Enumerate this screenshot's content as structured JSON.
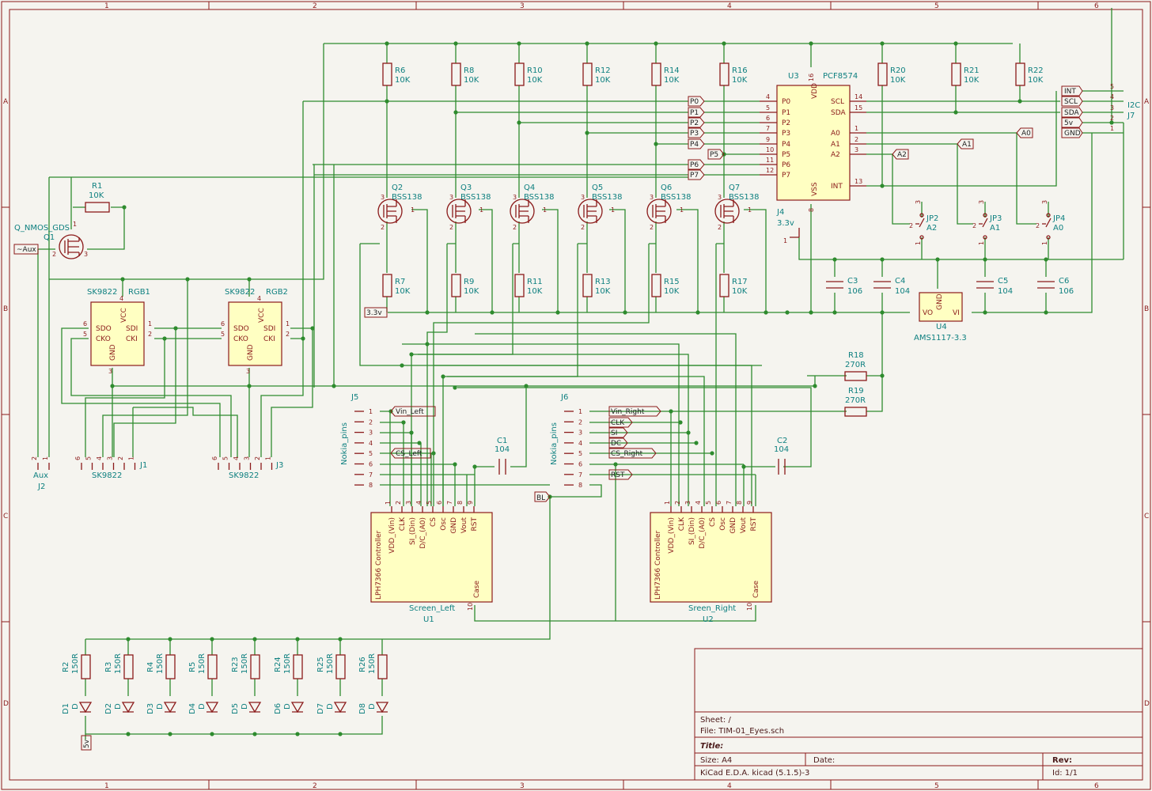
{
  "grid": {
    "cols": [
      "1",
      "2",
      "3",
      "4",
      "5",
      "6"
    ],
    "rows": [
      "A",
      "B",
      "C",
      "D"
    ]
  },
  "q1": {
    "ref": "Q1",
    "name": "Q_NMOS_GDS"
  },
  "r1": {
    "ref": "R1",
    "value": "10K"
  },
  "aux_label": "~Aux",
  "pullups": [
    {
      "ref": "R6",
      "value": "10K"
    },
    {
      "ref": "R8",
      "value": "10K"
    },
    {
      "ref": "R10",
      "value": "10K"
    },
    {
      "ref": "R12",
      "value": "10K"
    },
    {
      "ref": "R14",
      "value": "10K"
    },
    {
      "ref": "R16",
      "value": "10K"
    }
  ],
  "fets": [
    {
      "ref": "Q2",
      "part": "BSS138"
    },
    {
      "ref": "Q3",
      "part": "BSS138"
    },
    {
      "ref": "Q4",
      "part": "BSS138"
    },
    {
      "ref": "Q5",
      "part": "BSS138"
    },
    {
      "ref": "Q6",
      "part": "BSS138"
    },
    {
      "ref": "Q7",
      "part": "BSS138"
    }
  ],
  "pulldowns": [
    {
      "ref": "R7",
      "value": "10K"
    },
    {
      "ref": "R9",
      "value": "10K"
    },
    {
      "ref": "R11",
      "value": "10K"
    },
    {
      "ref": "R13",
      "value": "10K"
    },
    {
      "ref": "R15",
      "value": "10K"
    },
    {
      "ref": "R17",
      "value": "10K"
    }
  ],
  "u3": {
    "ref": "U3",
    "part": "PCF8574",
    "left_pins": [
      [
        "4",
        "P0"
      ],
      [
        "5",
        "P1"
      ],
      [
        "6",
        "P2"
      ],
      [
        "7",
        "P3"
      ],
      [
        "9",
        "P4"
      ],
      [
        "10",
        "P5"
      ],
      [
        "11",
        "P6"
      ],
      [
        "12",
        "P7"
      ]
    ],
    "right_pins": [
      [
        "14",
        "SCL"
      ],
      [
        "15",
        "SDA"
      ],
      [
        "1",
        "A0"
      ],
      [
        "2",
        "A1"
      ],
      [
        "3",
        "A2"
      ],
      [
        "13",
        "INT"
      ]
    ],
    "vdd": "VDD",
    "vss": "VSS",
    "vdd_pin": "16",
    "vss_pin": "8"
  },
  "port_labels": [
    "P0",
    "P1",
    "P2",
    "P3",
    "P4",
    "P5",
    "P6",
    "P7"
  ],
  "addr_res": [
    {
      "ref": "R20",
      "value": "10K"
    },
    {
      "ref": "R21",
      "value": "10K"
    },
    {
      "ref": "R22",
      "value": "10K"
    }
  ],
  "addr_labels": [
    "A2",
    "A1",
    "A0"
  ],
  "jumpers": [
    {
      "ref": "JP2",
      "name": "A2"
    },
    {
      "ref": "JP3",
      "name": "A1"
    },
    {
      "ref": "JP4",
      "name": "A0"
    }
  ],
  "j7": {
    "ref": "J7",
    "name": "I2C",
    "pins": [
      [
        "5",
        "INT"
      ],
      [
        "4",
        "SCL"
      ],
      [
        "3",
        "SDA"
      ],
      [
        "2",
        "5v"
      ],
      [
        "1",
        "GND"
      ]
    ]
  },
  "j4": {
    "ref": "J4",
    "name": "3.3v"
  },
  "caps": [
    {
      "ref": "C3",
      "value": "106"
    },
    {
      "ref": "C4",
      "value": "104"
    },
    {
      "ref": "C5",
      "value": "104"
    },
    {
      "ref": "C6",
      "value": "106"
    }
  ],
  "u4": {
    "ref": "U4",
    "part": "AMS1117-3.3",
    "gnd": "GND",
    "vo": "VO",
    "vi": "VI"
  },
  "label_33v": "3.3v",
  "rgb": [
    {
      "ref": "RGB1",
      "part": "SK9822"
    },
    {
      "ref": "RGB2",
      "part": "SK9822"
    }
  ],
  "rgb_pins": {
    "sdo": "SDO",
    "cko": "CKO",
    "gnd": "GND",
    "vcc": "VCC",
    "sdi": "SDI",
    "cki": "CKI"
  },
  "j1": {
    "ref": "J1",
    "name": "SK9822"
  },
  "j3": {
    "ref": "J3",
    "name": "SK9822"
  },
  "j2": {
    "ref": "J2",
    "name": "Aux"
  },
  "j5": {
    "ref": "J5",
    "name": "Nokia_pins"
  },
  "j6": {
    "ref": "J6",
    "name": "Nokia_pins"
  },
  "left_labels": [
    "Vin_Left",
    "CS_Left"
  ],
  "right_labels": [
    "Vin_Right",
    "CLK",
    "SI",
    "DC",
    "CS_Right",
    "RST"
  ],
  "bl_label": "BL",
  "c1": {
    "ref": "C1",
    "value": "104"
  },
  "c2": {
    "ref": "C2",
    "value": "104"
  },
  "r18": {
    "ref": "R18",
    "value": "270R"
  },
  "r19": {
    "ref": "R19",
    "value": "270R"
  },
  "lcd_pins": [
    "VDD_(Vin)",
    "CLK",
    "SI_(Din)",
    "D/C_(A0)",
    "CS",
    "Osc",
    "GND",
    "Vout",
    "RST"
  ],
  "lcd_case": "Case",
  "lcd_title": "LPH7366 Controller",
  "u1": {
    "ref": "U1",
    "name": "Screen_Left"
  },
  "u2": {
    "ref": "U2",
    "name": "Sreen_Right"
  },
  "leds": [
    {
      "r": "R2",
      "d": "D1"
    },
    {
      "r": "R3",
      "d": "D2"
    },
    {
      "r": "R4",
      "d": "D3"
    },
    {
      "r": "R5",
      "d": "D4"
    },
    {
      "r": "R23",
      "d": "D5"
    },
    {
      "r": "R24",
      "d": "D6"
    },
    {
      "r": "R25",
      "d": "D7"
    },
    {
      "r": "R26",
      "d": "D8"
    }
  ],
  "led_r_value": "150R",
  "led_d_value": "D",
  "label_5v": "5v",
  "title_block": {
    "sheet": "Sheet: /",
    "file": "File: TIM-01_Eyes.sch",
    "title": "Title:",
    "size": "Size: A4",
    "date": "Date:",
    "rev": "Rev:",
    "tool": "KiCad E.D.A.  kicad (5.1.5)-3",
    "id": "Id: 1/1"
  }
}
